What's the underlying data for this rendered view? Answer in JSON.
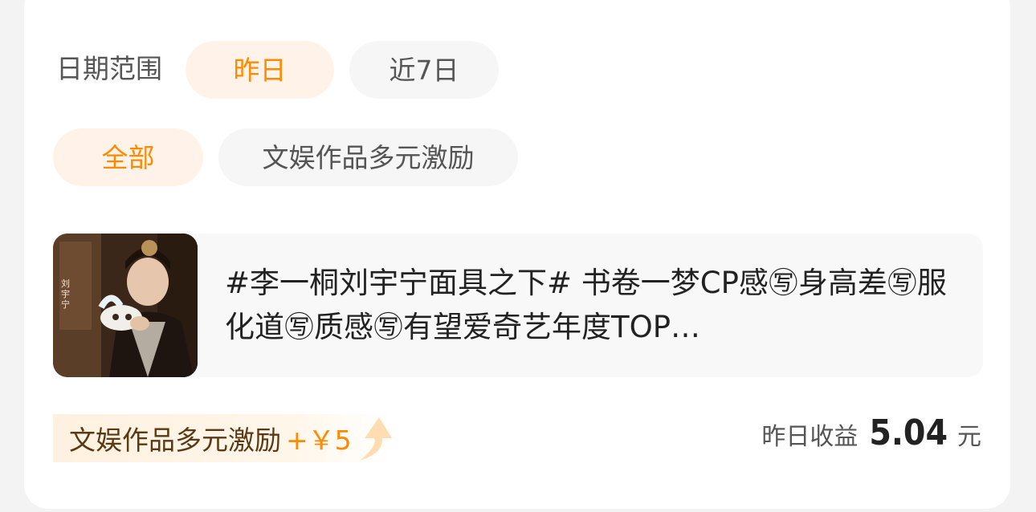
{
  "filters": {
    "date_label": "日期范围",
    "date_options": [
      "昨日",
      "近7日"
    ],
    "date_selected": "昨日",
    "category_options": [
      "全部",
      "文娱作品多元激励"
    ],
    "category_selected": "全部"
  },
  "post": {
    "text": "#李一桐刘宇宁面具之下# 书卷一梦CP感㊢身高差㊢服化道㊢质感㊢有望爱奇艺年度TOP…",
    "thumbnail_caption": "刘宇宁"
  },
  "bonus": {
    "name": "文娱作品多元激励",
    "amount": "+￥5",
    "icon": "up-arrow-icon"
  },
  "earnings": {
    "label": "昨日收益",
    "value": "5.04",
    "unit": "元"
  },
  "colors": {
    "accent": "#ff8a00",
    "accent_bg": "#fff3e9",
    "bonus_text": "#5a3a14"
  }
}
